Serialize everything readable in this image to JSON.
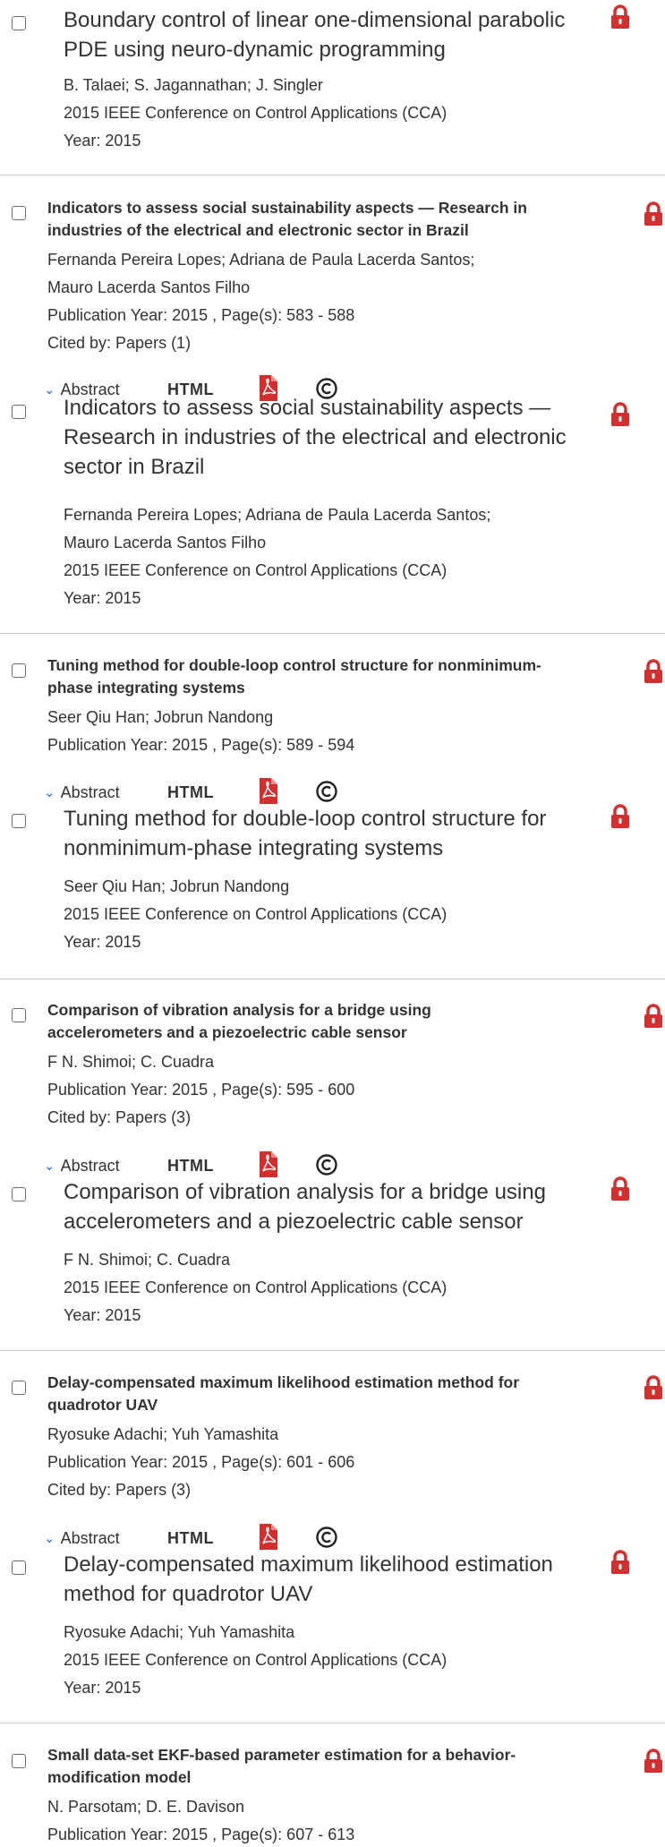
{
  "colors": {
    "lock": "#d32f2f",
    "pdf": "#d32f2f",
    "chevron": "#2a6ebb",
    "divider": "#c8c8c8",
    "text": "#333333"
  },
  "icons": {
    "lock": "lock-icon",
    "pdf": "pdf-icon",
    "copyright": "copyright-icon",
    "chevron": "chevron-down-icon"
  },
  "entries": [
    {
      "expanded": {
        "title_lines": [
          "Boundary control of linear one-dimensional parabolic",
          "PDE using neuro-dynamic programming"
        ],
        "authors_lines": [
          "B. Talaei; S. Jagannathan; J. Singler"
        ],
        "venue": "2015 IEEE Conference on Control Applications (CCA)",
        "year": "Year: 2015"
      }
    },
    {
      "summary": {
        "title_lines": [
          "Indicators to assess social sustainability aspects — Research in",
          "industries of the electrical and electronic sector in Brazil"
        ],
        "authors_lines": [
          "Fernanda Pereira Lopes; Adriana de Paula Lacerda Santos;",
          "Mauro Lacerda Santos Filho"
        ],
        "pub": "Publication Year: 2015 , Page(s): 583  -  588",
        "cited": "Cited by: Papers (1)"
      },
      "actions": {
        "abstract": "Abstract",
        "html": "HTML"
      },
      "expanded": {
        "title_lines": [
          "Indicators to assess social sustainability aspects —",
          "Research in industries of the electrical and electronic",
          "sector in Brazil"
        ],
        "authors_lines": [
          "Fernanda Pereira Lopes; Adriana de Paula Lacerda Santos;",
          "Mauro Lacerda Santos Filho"
        ],
        "venue": "2015 IEEE Conference on Control Applications (CCA)",
        "year": "Year: 2015"
      }
    },
    {
      "summary": {
        "title_lines": [
          "Tuning method for double-loop control structure for nonminimum-",
          "phase integrating systems"
        ],
        "authors_lines": [
          "Seer Qiu Han; Jobrun Nandong"
        ],
        "pub": "Publication Year: 2015 , Page(s): 589  -  594"
      },
      "actions": {
        "abstract": "Abstract",
        "html": "HTML"
      },
      "expanded": {
        "title_lines": [
          "Tuning method for double-loop control structure for",
          "nonminimum-phase integrating systems"
        ],
        "authors_lines": [
          "Seer Qiu Han; Jobrun Nandong"
        ],
        "venue": "2015 IEEE Conference on Control Applications (CCA)",
        "year": "Year: 2015"
      }
    },
    {
      "summary": {
        "title_lines": [
          "Comparison of vibration analysis for a bridge using",
          "accelerometers and a piezoelectric cable sensor"
        ],
        "authors_lines": [
          "F N. Shimoi; C. Cuadra"
        ],
        "pub": "Publication Year: 2015 , Page(s): 595  -  600",
        "cited": "Cited by: Papers (3)"
      },
      "actions": {
        "abstract": "Abstract",
        "html": "HTML"
      },
      "expanded": {
        "title_lines": [
          "Comparison of vibration analysis for a bridge using",
          "accelerometers and a piezoelectric cable sensor"
        ],
        "authors_lines": [
          "F N. Shimoi; C. Cuadra"
        ],
        "venue": "2015 IEEE Conference on Control Applications (CCA)",
        "year": "Year: 2015"
      }
    },
    {
      "summary": {
        "title_lines": [
          "Delay-compensated maximum likelihood estimation method for",
          "quadrotor UAV"
        ],
        "authors_lines": [
          "Ryosuke Adachi; Yuh Yamashita"
        ],
        "pub": "Publication Year: 2015 , Page(s): 601  -  606",
        "cited": "Cited by: Papers (3)"
      },
      "actions": {
        "abstract": "Abstract",
        "html": "HTML"
      },
      "expanded": {
        "title_lines": [
          "Delay-compensated maximum likelihood estimation",
          "method for quadrotor UAV"
        ],
        "authors_lines": [
          "Ryosuke Adachi; Yuh Yamashita"
        ],
        "venue": "2015 IEEE Conference on Control Applications (CCA)",
        "year": "Year: 2015"
      }
    },
    {
      "summary": {
        "title_lines": [
          "Small data-set EKF-based parameter estimation for a behavior-",
          "modification model"
        ],
        "authors_lines": [
          "N. Parsotam; D. E. Davison"
        ],
        "pub": "Publication Year: 2015 , Page(s): 607  -  613"
      }
    }
  ]
}
